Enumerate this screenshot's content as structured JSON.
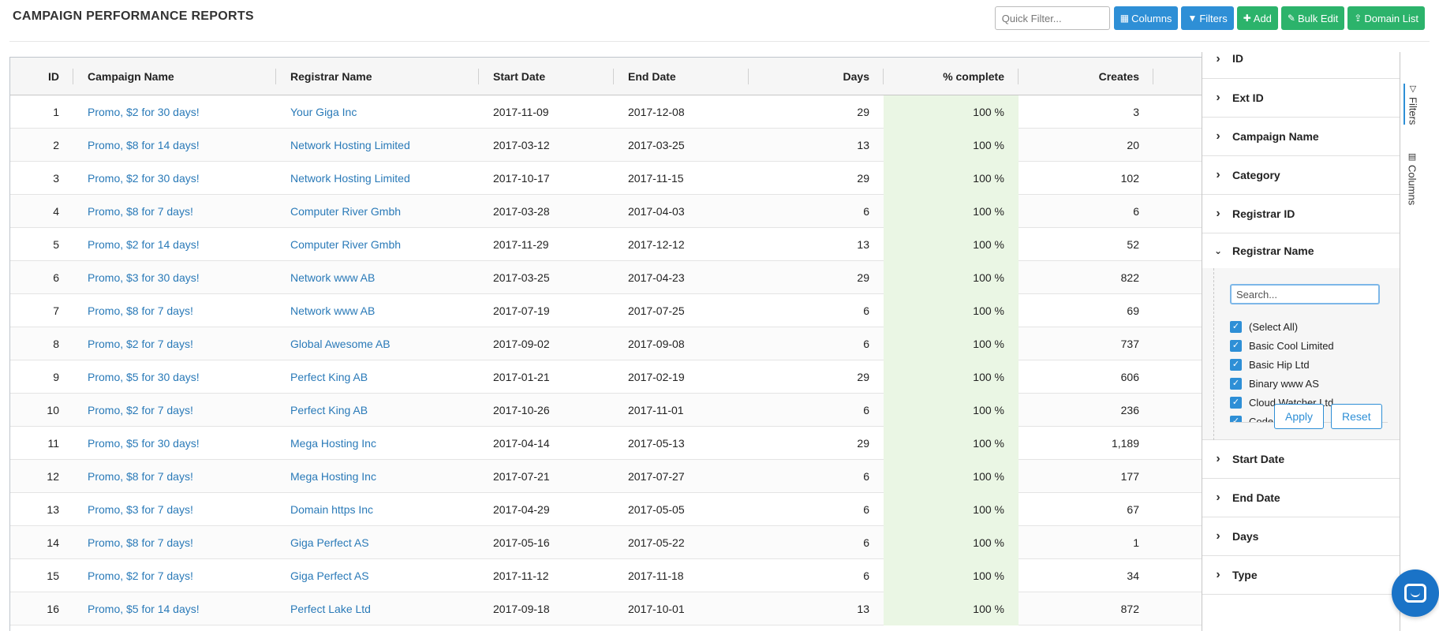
{
  "page": {
    "title": "CAMPAIGN PERFORMANCE REPORTS"
  },
  "toolbar": {
    "quick_filter_placeholder": "Quick Filter...",
    "buttons": [
      {
        "label": "Columns",
        "icon": "table-icon",
        "color": "#2e8fd6"
      },
      {
        "label": "Filters",
        "icon": "funnel-icon",
        "color": "#2e8fd6"
      },
      {
        "label": "Add",
        "icon": "plus-icon",
        "color": "#2cb36b"
      },
      {
        "label": "Bulk Edit",
        "icon": "edit-icon",
        "color": "#2cb36b"
      },
      {
        "label": "Domain List",
        "icon": "upload-icon",
        "color": "#2cb36b"
      }
    ]
  },
  "grid": {
    "columns": [
      "ID",
      "Campaign Name",
      "Registrar Name",
      "Start Date",
      "End Date",
      "Days",
      "% complete",
      "Creates"
    ],
    "rows": [
      [
        "1",
        "Promo, $2 for 30 days!",
        "Your Giga Inc",
        "2017-11-09",
        "2017-12-08",
        "29",
        "100 %",
        "3"
      ],
      [
        "2",
        "Promo, $8 for 14 days!",
        "Network Hosting Limited",
        "2017-03-12",
        "2017-03-25",
        "13",
        "100 %",
        "20"
      ],
      [
        "3",
        "Promo, $2 for 30 days!",
        "Network Hosting Limited",
        "2017-10-17",
        "2017-11-15",
        "29",
        "100 %",
        "102"
      ],
      [
        "4",
        "Promo, $8 for 7 days!",
        "Computer River Gmbh",
        "2017-03-28",
        "2017-04-03",
        "6",
        "100 %",
        "6"
      ],
      [
        "5",
        "Promo, $2 for 14 days!",
        "Computer River Gmbh",
        "2017-11-29",
        "2017-12-12",
        "13",
        "100 %",
        "52"
      ],
      [
        "6",
        "Promo, $3 for 30 days!",
        "Network www AB",
        "2017-03-25",
        "2017-04-23",
        "29",
        "100 %",
        "822"
      ],
      [
        "7",
        "Promo, $8 for 7 days!",
        "Network www AB",
        "2017-07-19",
        "2017-07-25",
        "6",
        "100 %",
        "69"
      ],
      [
        "8",
        "Promo, $2 for 7 days!",
        "Global Awesome AB",
        "2017-09-02",
        "2017-09-08",
        "6",
        "100 %",
        "737"
      ],
      [
        "9",
        "Promo, $5 for 30 days!",
        "Perfect King AB",
        "2017-01-21",
        "2017-02-19",
        "29",
        "100 %",
        "606"
      ],
      [
        "10",
        "Promo, $2 for 7 days!",
        "Perfect King AB",
        "2017-10-26",
        "2017-11-01",
        "6",
        "100 %",
        "236"
      ],
      [
        "11",
        "Promo, $5 for 30 days!",
        "Mega Hosting Inc",
        "2017-04-14",
        "2017-05-13",
        "29",
        "100 %",
        "1,189"
      ],
      [
        "12",
        "Promo, $8 for 7 days!",
        "Mega Hosting Inc",
        "2017-07-21",
        "2017-07-27",
        "6",
        "100 %",
        "177"
      ],
      [
        "13",
        "Promo, $3 for 7 days!",
        "Domain https Inc",
        "2017-04-29",
        "2017-05-05",
        "6",
        "100 %",
        "67"
      ],
      [
        "14",
        "Promo, $8 for 7 days!",
        "Giga Perfect AS",
        "2017-05-16",
        "2017-05-22",
        "6",
        "100 %",
        "1"
      ],
      [
        "15",
        "Promo, $2 for 7 days!",
        "Giga Perfect AS",
        "2017-11-12",
        "2017-11-18",
        "6",
        "100 %",
        "34"
      ],
      [
        "16",
        "Promo, $5 for 14 days!",
        "Perfect Lake Ltd",
        "2017-09-18",
        "2017-10-01",
        "13",
        "100 %",
        "872"
      ]
    ]
  },
  "filter_panel": {
    "items_before": [
      "ID",
      "Ext ID",
      "Campaign Name",
      "Category",
      "Registrar ID"
    ],
    "expanded": {
      "label": "Registrar Name",
      "search_placeholder": "Search...",
      "options": [
        "(Select All)",
        "Basic Cool Limited",
        "Basic Hip Ltd",
        "Binary www AS",
        "Cloud Watcher Ltd",
        "Code Desert AS"
      ],
      "apply_label": "Apply",
      "reset_label": "Reset"
    },
    "items_after": [
      "Start Date",
      "End Date",
      "Days",
      "Type"
    ]
  },
  "side_tabs": {
    "filters": "Filters",
    "columns": "Columns"
  },
  "colors": {
    "accent": "#2e8fd6",
    "success": "#2cb36b",
    "link": "#2a7ab8",
    "complete_bg": "#eaf6e4"
  }
}
